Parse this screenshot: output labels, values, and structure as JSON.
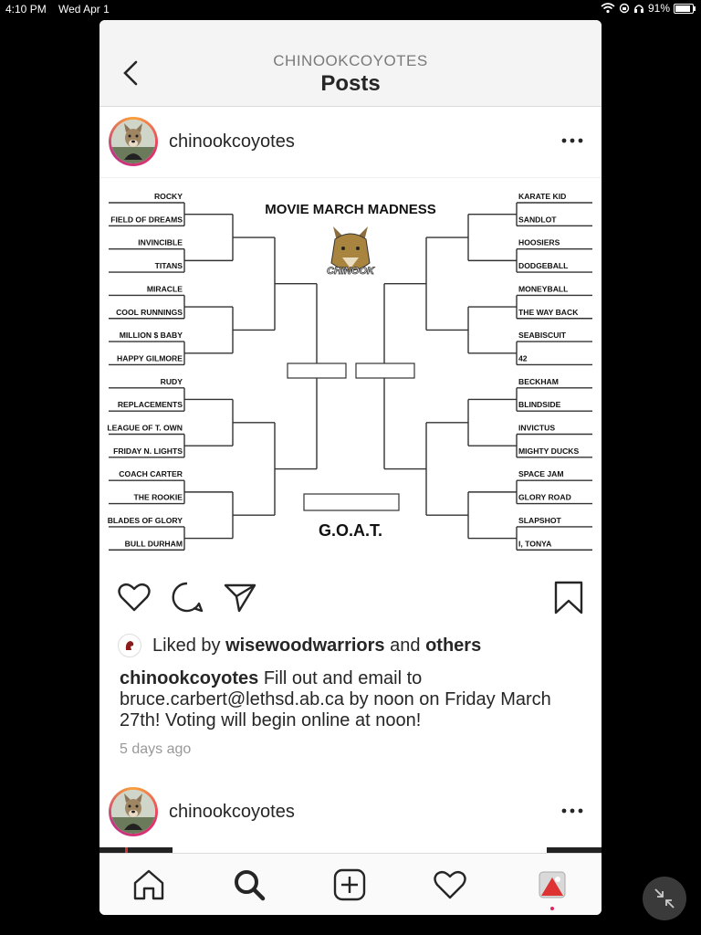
{
  "status_bar": {
    "time": "4:10 PM",
    "date": "Wed Apr 1",
    "battery": "91%"
  },
  "header": {
    "account": "CHINOOKCOYOTES",
    "title": "Posts"
  },
  "post": {
    "username": "chinookcoyotes",
    "image": {
      "title": "MOVIE MARCH MADNESS",
      "logo_text": "CHINOOK",
      "final_label": "G.O.A.T.",
      "left_bracket": [
        "ROCKY",
        "FIELD OF DREAMS",
        "INVINCIBLE",
        "TITANS",
        "MIRACLE",
        "COOL RUNNINGS",
        "MILLION $ BABY",
        "HAPPY GILMORE",
        "RUDY",
        "REPLACEMENTS",
        "LEAGUE OF T. OWN",
        "FRIDAY N. LIGHTS",
        "COACH CARTER",
        "THE ROOKIE",
        "BLADES OF GLORY",
        "BULL DURHAM"
      ],
      "right_bracket": [
        "KARATE KID",
        "SANDLOT",
        "HOOSIERS",
        "DODGEBALL",
        "MONEYBALL",
        "THE WAY BACK",
        "SEABISCUIT",
        "42",
        "BECKHAM",
        "BLINDSIDE",
        "INVICTUS",
        "MIGHTY DUCKS",
        "SPACE JAM",
        "GLORY ROAD",
        "SLAPSHOT",
        "I, TONYA"
      ]
    },
    "liked_prefix": "Liked by",
    "liked_user": "wisewoodwarriors",
    "liked_and": "and",
    "liked_others": "others",
    "caption_user": "chinookcoyotes",
    "caption_text": "Fill out and email to bruce.carbert@lethsd.ab.ca by noon on Friday March 27th! Voting will begin online at noon!",
    "time_ago": "5 days ago"
  },
  "next_post": {
    "username": "chinookcoyotes"
  },
  "icons": {
    "back": "chevron-left-icon",
    "more": "more-icon",
    "like": "heart-icon",
    "comment": "comment-icon",
    "share": "send-icon",
    "save": "bookmark-icon",
    "home": "home-icon",
    "search": "search-icon",
    "new_post": "add-post-icon",
    "activity": "heart-icon",
    "profile": "profile-icon",
    "minimize": "minimize-icon"
  },
  "colors": {
    "story_ring": "#e1306c",
    "text": "#262626",
    "muted": "#999999",
    "notification": "#e0245e"
  }
}
